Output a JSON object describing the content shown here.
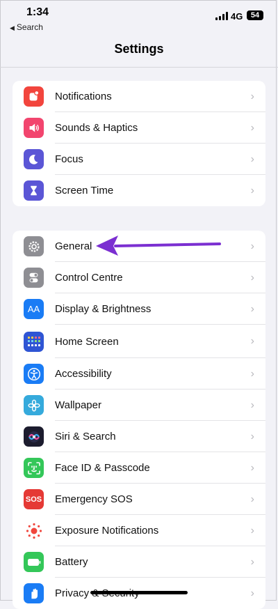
{
  "status_bar": {
    "time": "1:34",
    "back_label": "Search",
    "network": "4G",
    "battery": "54"
  },
  "nav": {
    "title": "Settings"
  },
  "groups": [
    {
      "items": [
        {
          "label": "Notifications",
          "icon": "bell-icon",
          "color": "#f2453d"
        },
        {
          "label": "Sounds & Haptics",
          "icon": "speaker-icon",
          "color": "#f2456e"
        },
        {
          "label": "Focus",
          "icon": "moon-icon",
          "color": "#5b56d6"
        },
        {
          "label": "Screen Time",
          "icon": "hourglass-icon",
          "color": "#5b56d6"
        }
      ]
    },
    {
      "items": [
        {
          "label": "General",
          "icon": "gear-icon",
          "color": "#8e8e93"
        },
        {
          "label": "Control Centre",
          "icon": "toggles-icon",
          "color": "#8e8e93"
        },
        {
          "label": "Display & Brightness",
          "icon": "text-size-icon",
          "color": "#1a7cf5"
        },
        {
          "label": "Home Screen",
          "icon": "app-grid-icon",
          "color": "#2f55d4"
        },
        {
          "label": "Accessibility",
          "icon": "accessibility-icon",
          "color": "#1a7cf5"
        },
        {
          "label": "Wallpaper",
          "icon": "flower-icon",
          "color": "#35aadc"
        },
        {
          "label": "Siri & Search",
          "icon": "siri-icon",
          "color": "#1c1c2e"
        },
        {
          "label": "Face ID & Passcode",
          "icon": "face-id-icon",
          "color": "#34c759"
        },
        {
          "label": "Emergency SOS",
          "icon": "sos-icon",
          "color": "#e53935"
        },
        {
          "label": "Exposure Notifications",
          "icon": "exposure-icon",
          "color": "#ffffff"
        },
        {
          "label": "Battery",
          "icon": "battery-icon",
          "color": "#34c759"
        },
        {
          "label": "Privacy & Security",
          "icon": "hand-icon",
          "color": "#1a7cf5"
        }
      ]
    }
  ],
  "annotation": {
    "arrow_color": "#7b2fd1"
  }
}
